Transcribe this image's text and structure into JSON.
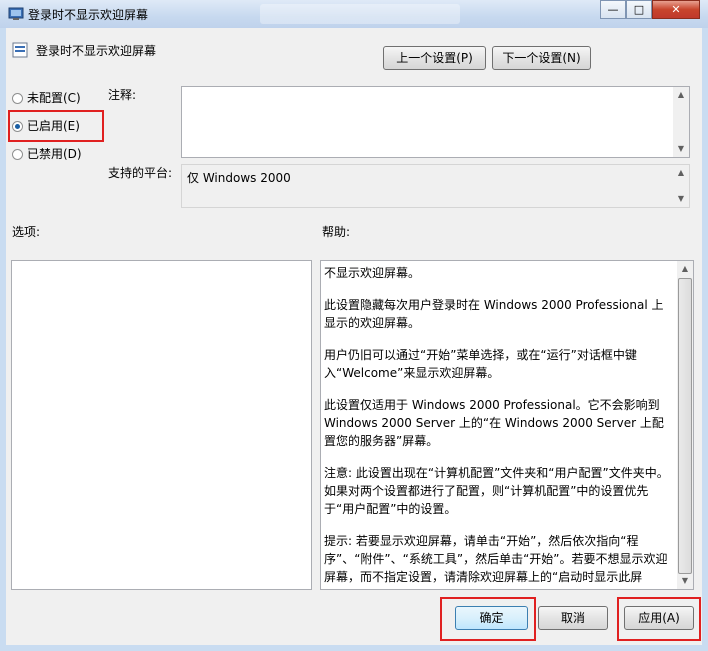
{
  "window": {
    "title": "登录时不显示欢迎屏幕",
    "minimize_glyph": "—",
    "maximize_glyph": "□",
    "close_glyph": "✕"
  },
  "policy": {
    "name": "登录时不显示欢迎屏幕"
  },
  "nav": {
    "prev_label": "上一个设置(P)",
    "next_label": "下一个设置(N)"
  },
  "state": {
    "not_configured": "未配置(C)",
    "enabled": "已启用(E)",
    "disabled": "已禁用(D)",
    "selected": "enabled"
  },
  "comment": {
    "label": "注释:",
    "value": ""
  },
  "platform": {
    "label": "支持的平台:",
    "value": "仅 Windows 2000"
  },
  "options": {
    "label": "选项:"
  },
  "help": {
    "label": "帮助:",
    "paragraphs": [
      "不显示欢迎屏幕。",
      "此设置隐藏每次用户登录时在 Windows 2000 Professional 上显示的欢迎屏幕。",
      "用户仍旧可以通过“开始”菜单选择，或在“运行”对话框中键入“Welcome”来显示欢迎屏幕。",
      "此设置仅适用于 Windows 2000 Professional。它不会影响到 Windows 2000 Server 上的“在 Windows 2000 Server 上配置您的服务器”屏幕。",
      "注意: 此设置出现在“计算机配置”文件夹和“用户配置”文件夹中。如果对两个设置都进行了配置，则“计算机配置”中的设置优先于“用户配置”中的设置。",
      "提示: 若要显示欢迎屏幕，请单击“开始”，然后依次指向“程序”、“附件”、“系统工具”，然后单击“开始”。若要不想显示欢迎屏幕，而不指定设置，请清除欢迎屏幕上的“启动时显示此屏"
    ]
  },
  "footer": {
    "ok_label": "确定",
    "cancel_label": "取消",
    "apply_label": "应用(A)"
  },
  "colors": {
    "highlight_box": "#e02020",
    "accent": "#1b5fa4"
  }
}
